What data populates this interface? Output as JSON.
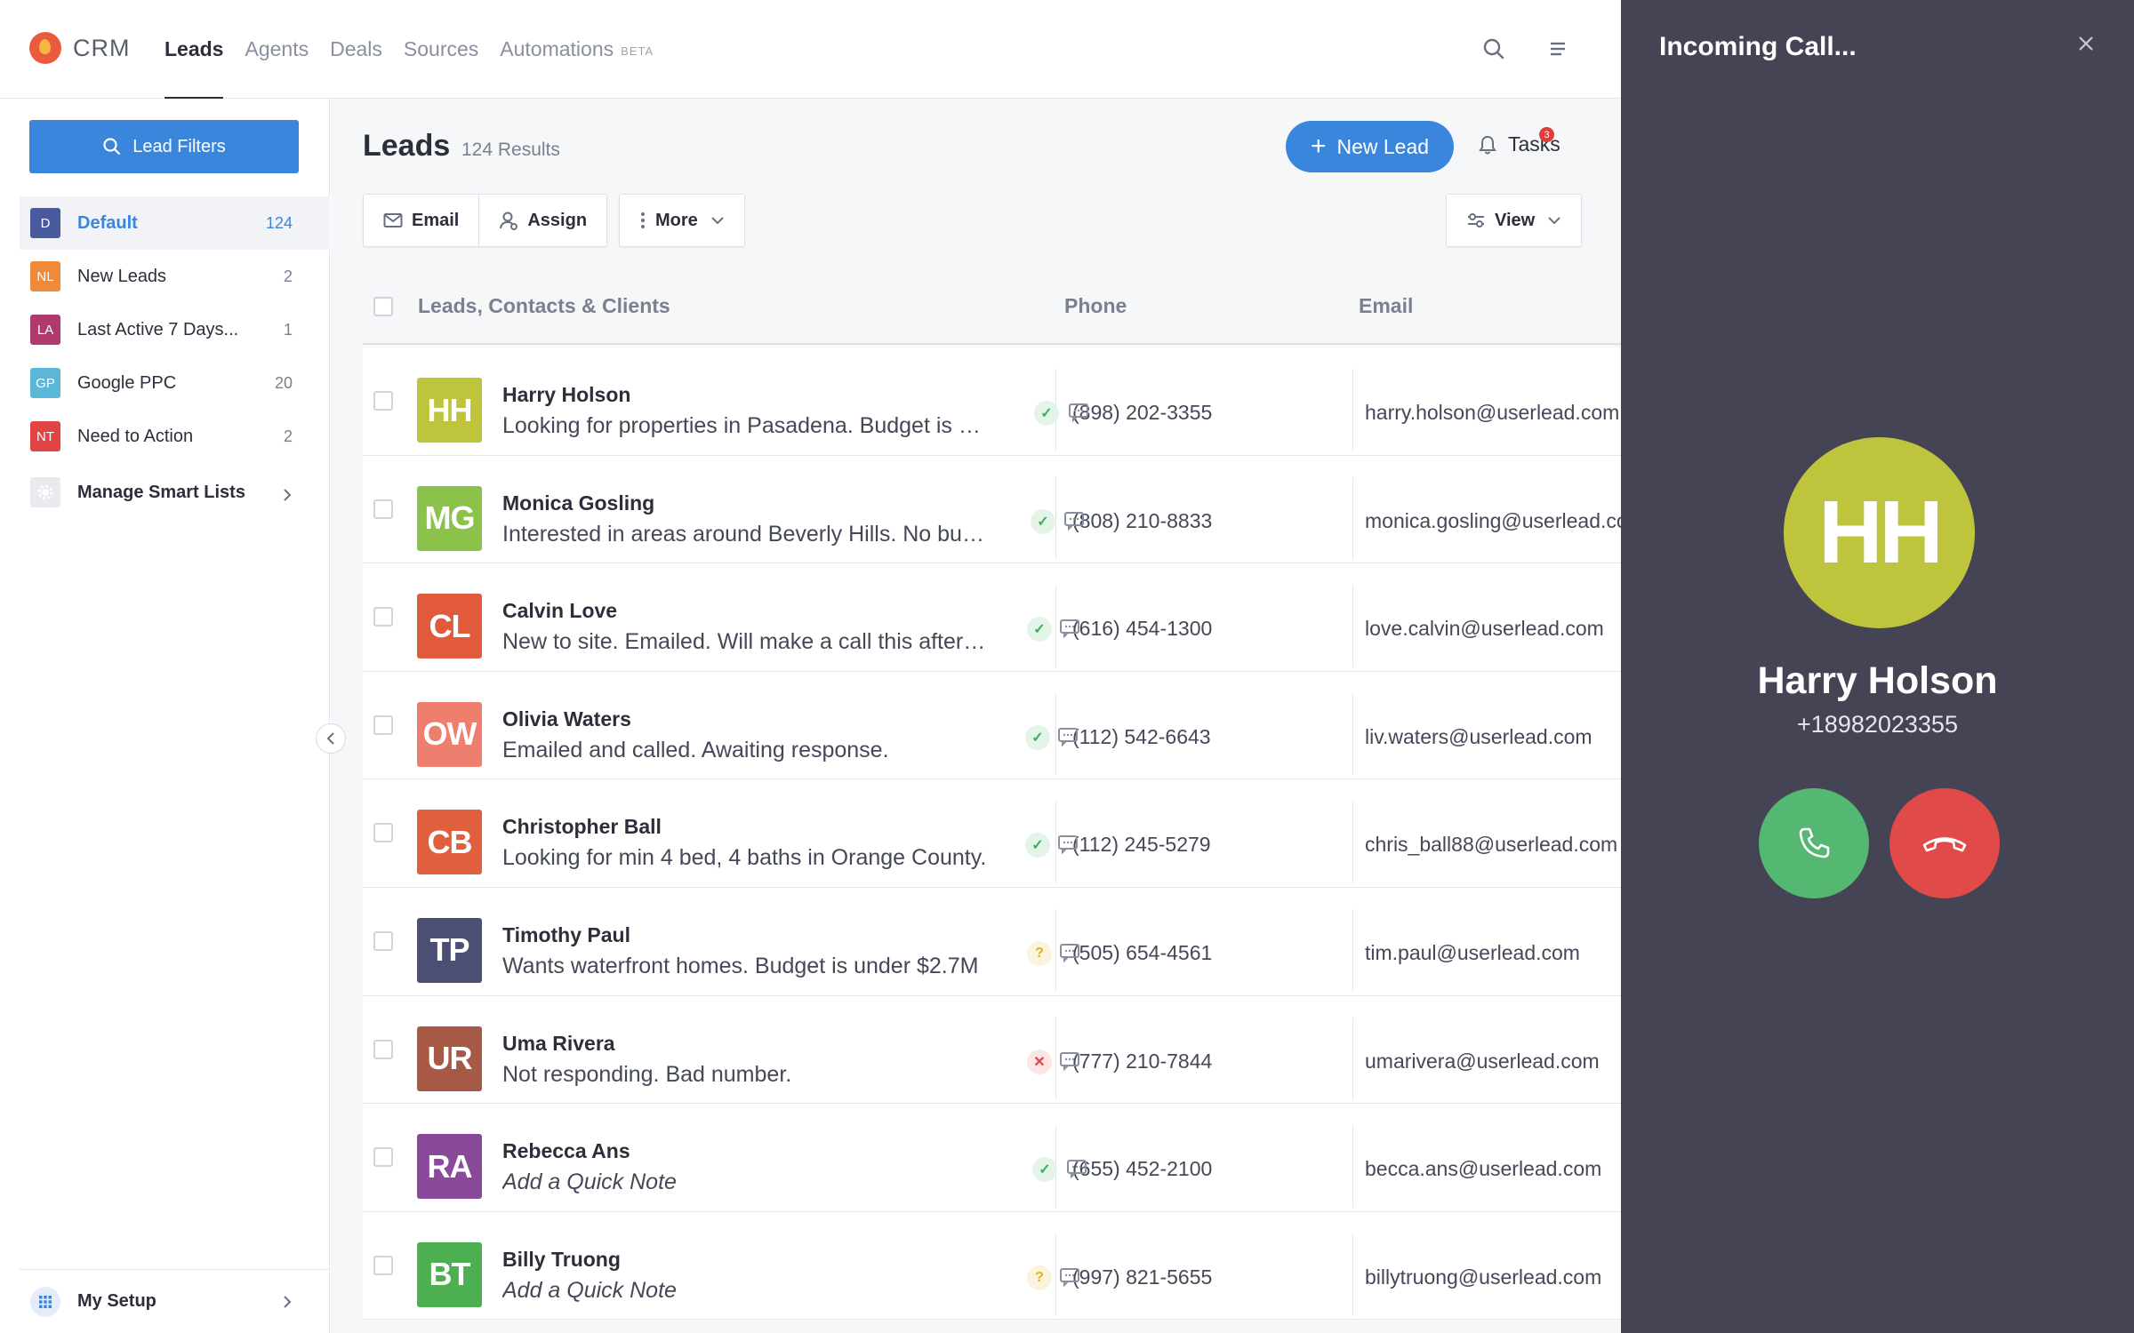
{
  "brand": {
    "name": "CRM"
  },
  "nav": [
    {
      "label": "Leads",
      "active": true
    },
    {
      "label": "Agents"
    },
    {
      "label": "Deals"
    },
    {
      "label": "Sources"
    },
    {
      "label": "Automations",
      "badge": "BETA"
    }
  ],
  "sidebar": {
    "filter_label": "Lead Filters",
    "items": [
      {
        "badge": "D",
        "label": "Default",
        "count": "124",
        "color": "#4a5a9e",
        "active": true
      },
      {
        "badge": "NL",
        "label": "New Leads",
        "count": "2",
        "color": "#ee8a3a"
      },
      {
        "badge": "LA",
        "label": "Last Active 7 Days...",
        "count": "1",
        "color": "#b03a6e"
      },
      {
        "badge": "GP",
        "label": "Google PPC",
        "count": "20",
        "color": "#5bb7d6"
      },
      {
        "badge": "NT",
        "label": "Need to Action",
        "count": "2",
        "color": "#e04444"
      }
    ],
    "manage_label": "Manage Smart Lists",
    "my_setup_label": "My Setup"
  },
  "main": {
    "title": "Leads",
    "results": "124 Results",
    "new_lead_label": "New Lead",
    "tasks_label": "Tasks",
    "tasks_count": "3",
    "toolbar": {
      "email": "Email",
      "assign": "Assign",
      "more": "More",
      "view": "View"
    },
    "columns": {
      "leads": "Leads, Contacts & Clients",
      "phone": "Phone",
      "email": "Email"
    }
  },
  "leads": [
    {
      "initials": "HH",
      "color": "#bec53c",
      "name": "Harry Holson",
      "note": "Looking for properties in Pasadena. Budget is $...",
      "phone": "(898) 202-3355",
      "status": "ok",
      "email": "harry.holson@userlead.com"
    },
    {
      "initials": "MG",
      "color": "#8bc34a",
      "name": "Monica Gosling",
      "note": "Interested in areas around Beverly Hills. No bud...",
      "phone": "(808) 210-8833",
      "status": "ok",
      "email": "monica.gosling@userlead.com"
    },
    {
      "initials": "CL",
      "color": "#e15a3b",
      "name": "Calvin Love",
      "note": "New to site. Emailed. Will make a call this aftern...",
      "phone": "(616) 454-1300",
      "status": "ok",
      "email": "love.calvin@userlead.com"
    },
    {
      "initials": "OW",
      "color": "#ee7e6e",
      "name": "Olivia Waters",
      "note": "Emailed and called. Awaiting response.",
      "phone": "(112) 542-6643",
      "status": "ok",
      "email": "liv.waters@userlead.com"
    },
    {
      "initials": "CB",
      "color": "#e0603e",
      "name": "Christopher Ball",
      "note": "Looking for min 4 bed, 4 baths in Orange County.",
      "phone": "(112) 245-5279",
      "status": "ok",
      "email": "chris_ball88@userlead.com"
    },
    {
      "initials": "TP",
      "color": "#4a4f73",
      "name": "Timothy Paul",
      "note": "Wants waterfront homes. Budget is under $2.7M",
      "phone": "(505) 654-4561",
      "status": "unknown",
      "email": "tim.paul@userlead.com"
    },
    {
      "initials": "UR",
      "color": "#a65a45",
      "name": "Uma Rivera",
      "note": "Not responding. Bad number.",
      "phone": "(777) 210-7844",
      "status": "bad",
      "email": "umarivera@userlead.com"
    },
    {
      "initials": "RA",
      "color": "#8a4a9a",
      "name": "Rebecca Ans",
      "note": "Add a Quick Note",
      "placeholder": true,
      "phone": "(655) 452-2100",
      "status": "ok",
      "email": "becca.ans@userlead.com"
    },
    {
      "initials": "BT",
      "color": "#4caf50",
      "name": "Billy Truong",
      "note": "Add a Quick Note",
      "placeholder": true,
      "phone": "(997) 821-5655",
      "status": "unknown",
      "email": "billytruong@userlead.com"
    }
  ],
  "call": {
    "title": "Incoming Call...",
    "initials": "HH",
    "name": "Harry Holson",
    "number": "+18982023355"
  }
}
